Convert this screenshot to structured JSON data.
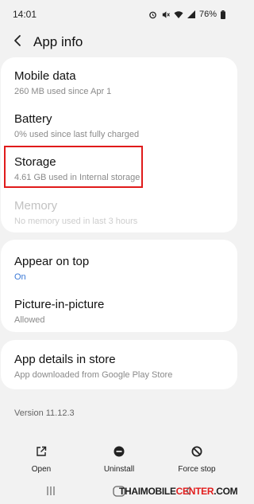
{
  "status_bar": {
    "time": "14:01",
    "battery": "76%"
  },
  "header": {
    "title": "App info"
  },
  "usage": {
    "mobile_data": {
      "title": "Mobile data",
      "subtitle": "260 MB used since Apr 1"
    },
    "battery": {
      "title": "Battery",
      "subtitle": "0% used since last fully charged"
    },
    "storage": {
      "title": "Storage",
      "subtitle": "4.61 GB used in Internal storage"
    },
    "memory": {
      "title": "Memory",
      "subtitle": "No memory used in last 3 hours"
    }
  },
  "permissions": {
    "appear_on_top": {
      "title": "Appear on top",
      "subtitle": "On"
    },
    "pip": {
      "title": "Picture-in-picture",
      "subtitle": "Allowed"
    }
  },
  "store": {
    "title": "App details in store",
    "subtitle": "App downloaded from Google Play Store"
  },
  "version": "Version 11.12.3",
  "actions": [
    {
      "label": "Open",
      "icon": "open-external-icon"
    },
    {
      "label": "Uninstall",
      "icon": "uninstall-icon"
    },
    {
      "label": "Force stop",
      "icon": "force-stop-icon"
    }
  ],
  "watermark": {
    "part1": "THAIMOBILE",
    "part2": "CENTER",
    "part3": ".COM"
  },
  "colors": {
    "accent_blue": "#3a78d6",
    "highlight_red": "#e01b1b",
    "background": "#f2f2f2",
    "card": "#ffffff"
  }
}
